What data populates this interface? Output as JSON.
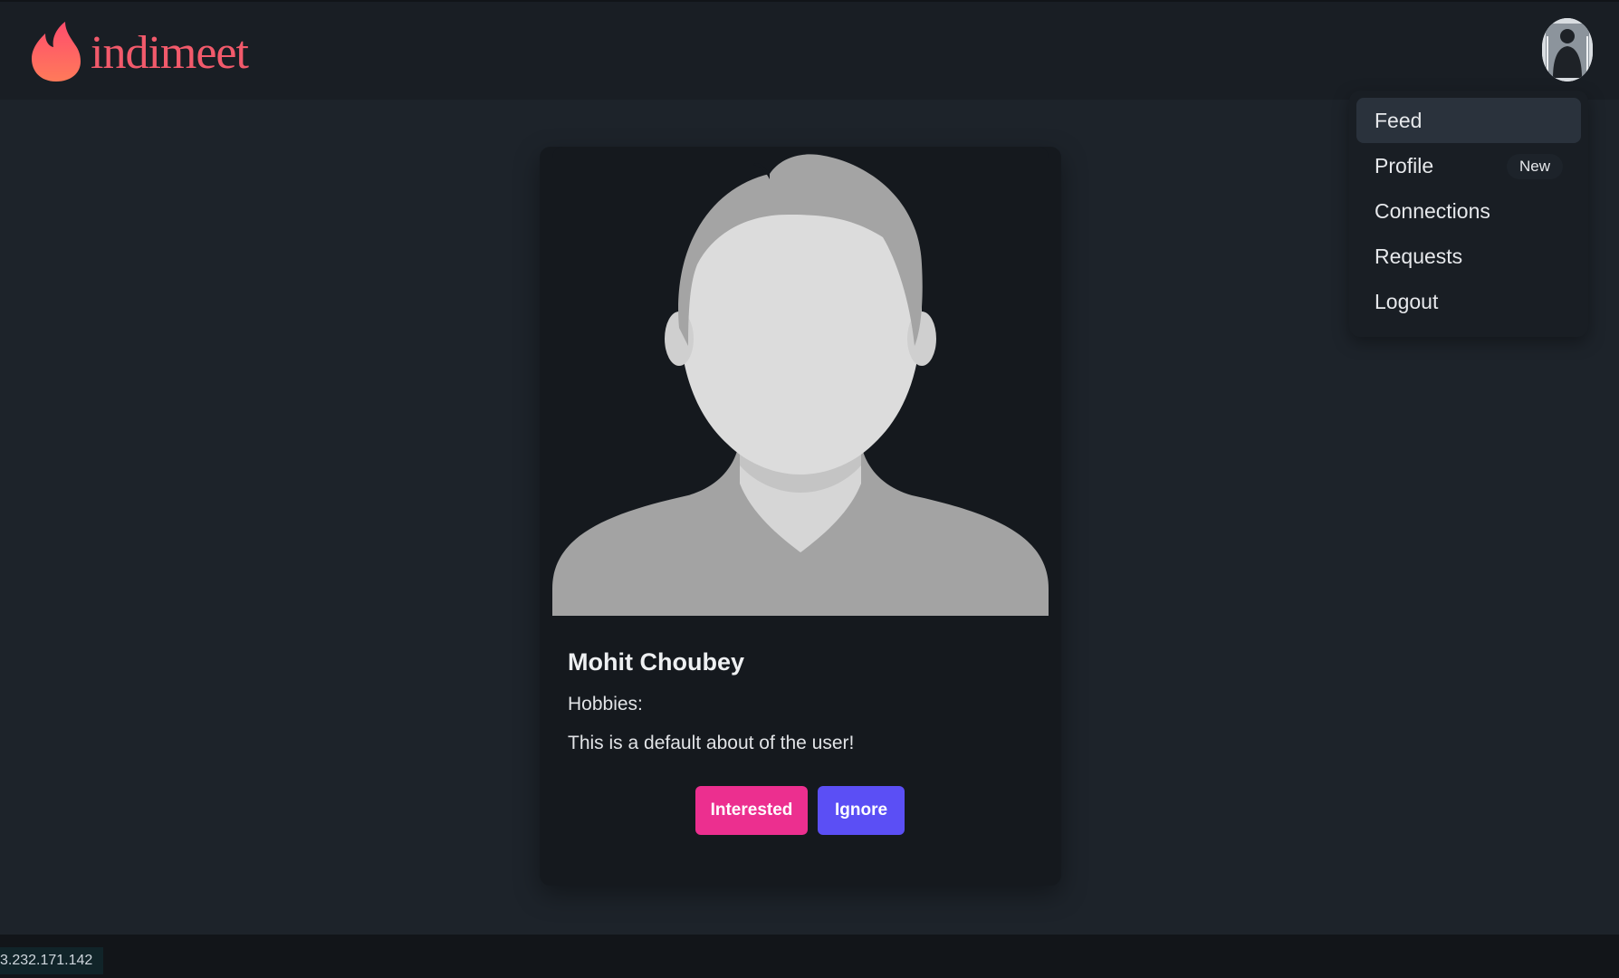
{
  "app": {
    "brand_name": "indimeet",
    "accent_color": "#f25a6b"
  },
  "header": {
    "logo_icon": "flame-icon",
    "avatar_icon": "user-avatar"
  },
  "menu": {
    "items": [
      {
        "label": "Feed",
        "active": true
      },
      {
        "label": "Profile",
        "badge": "New"
      },
      {
        "label": "Connections"
      },
      {
        "label": "Requests"
      },
      {
        "label": "Logout"
      }
    ]
  },
  "card": {
    "photo_icon": "default-profile-silhouette",
    "name": "Mohit Choubey",
    "hobbies": "Hobbies:",
    "about": "This is a default about of the user!",
    "buttons": {
      "interested": "Interested",
      "ignore": "Ignore"
    },
    "colors": {
      "interested": "#ec2f8f",
      "ignore": "#5b4ff5"
    }
  },
  "status_bar": {
    "ip": "3.232.171.142"
  }
}
